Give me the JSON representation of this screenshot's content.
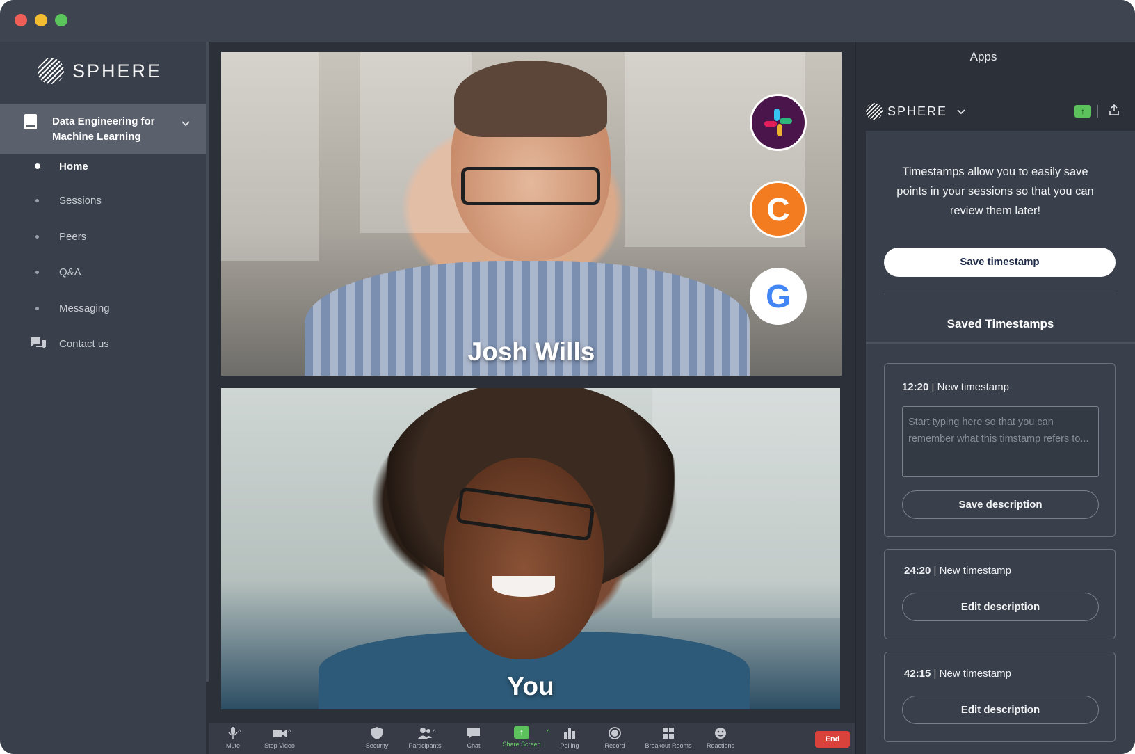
{
  "app": {
    "brand": "SPHERE"
  },
  "sidebar": {
    "course_title": "Data Engineering for Machine Learning",
    "items": [
      {
        "label": "Home",
        "active": true
      },
      {
        "label": "Sessions",
        "active": false
      },
      {
        "label": "Peers",
        "active": false
      },
      {
        "label": "Q&A",
        "active": false
      },
      {
        "label": "Messaging",
        "active": false
      },
      {
        "label": "Contact us",
        "active": false,
        "icon": "chat-bubbles-icon"
      }
    ]
  },
  "video": {
    "tiles": [
      {
        "name": "Josh Wills"
      },
      {
        "name": "You"
      }
    ],
    "app_badges": [
      {
        "icon": "slack-icon",
        "color": "#4a154b"
      },
      {
        "icon": "c-logo-icon",
        "color": "#f47c20",
        "glyph": "C"
      },
      {
        "icon": "google-icon",
        "color": "#ffffff",
        "glyph": "G"
      }
    ]
  },
  "toolbar": {
    "items": [
      {
        "label": "Mute",
        "icon": "microphone-icon"
      },
      {
        "label": "Stop Video",
        "icon": "video-camera-icon"
      },
      {
        "label": "Security",
        "icon": "shield-icon"
      },
      {
        "label": "Participants",
        "icon": "participants-icon"
      },
      {
        "label": "Chat",
        "icon": "chat-icon"
      },
      {
        "label": "Share Screen",
        "icon": "share-screen-icon"
      },
      {
        "label": "Polling",
        "icon": "bar-chart-icon"
      },
      {
        "label": "Record",
        "icon": "record-icon"
      },
      {
        "label": "Breakout Rooms",
        "icon": "grid-icon"
      },
      {
        "label": "Reactions",
        "icon": "emoji-icon"
      }
    ],
    "end_label": "End",
    "accent_green": "#5cc25c",
    "end_color": "#d9413b"
  },
  "panel": {
    "title": "Apps",
    "app_name": "SPHERE",
    "intro": "Timestamps allow you to easily save points in your sessions so that you can review them later!",
    "save_timestamp_label": "Save timestamp",
    "saved_title": "Saved Timestamps",
    "timestamps": [
      {
        "time": "12:20",
        "title": "New timestamp",
        "placeholder": "Start typing here so that you can remember what this timstamp refers to...",
        "button": "Save description"
      },
      {
        "time": "24:20",
        "title": "New timestamp",
        "button": "Edit description"
      },
      {
        "time": "42:15",
        "title": "New timestamp",
        "button": "Edit description"
      }
    ]
  }
}
